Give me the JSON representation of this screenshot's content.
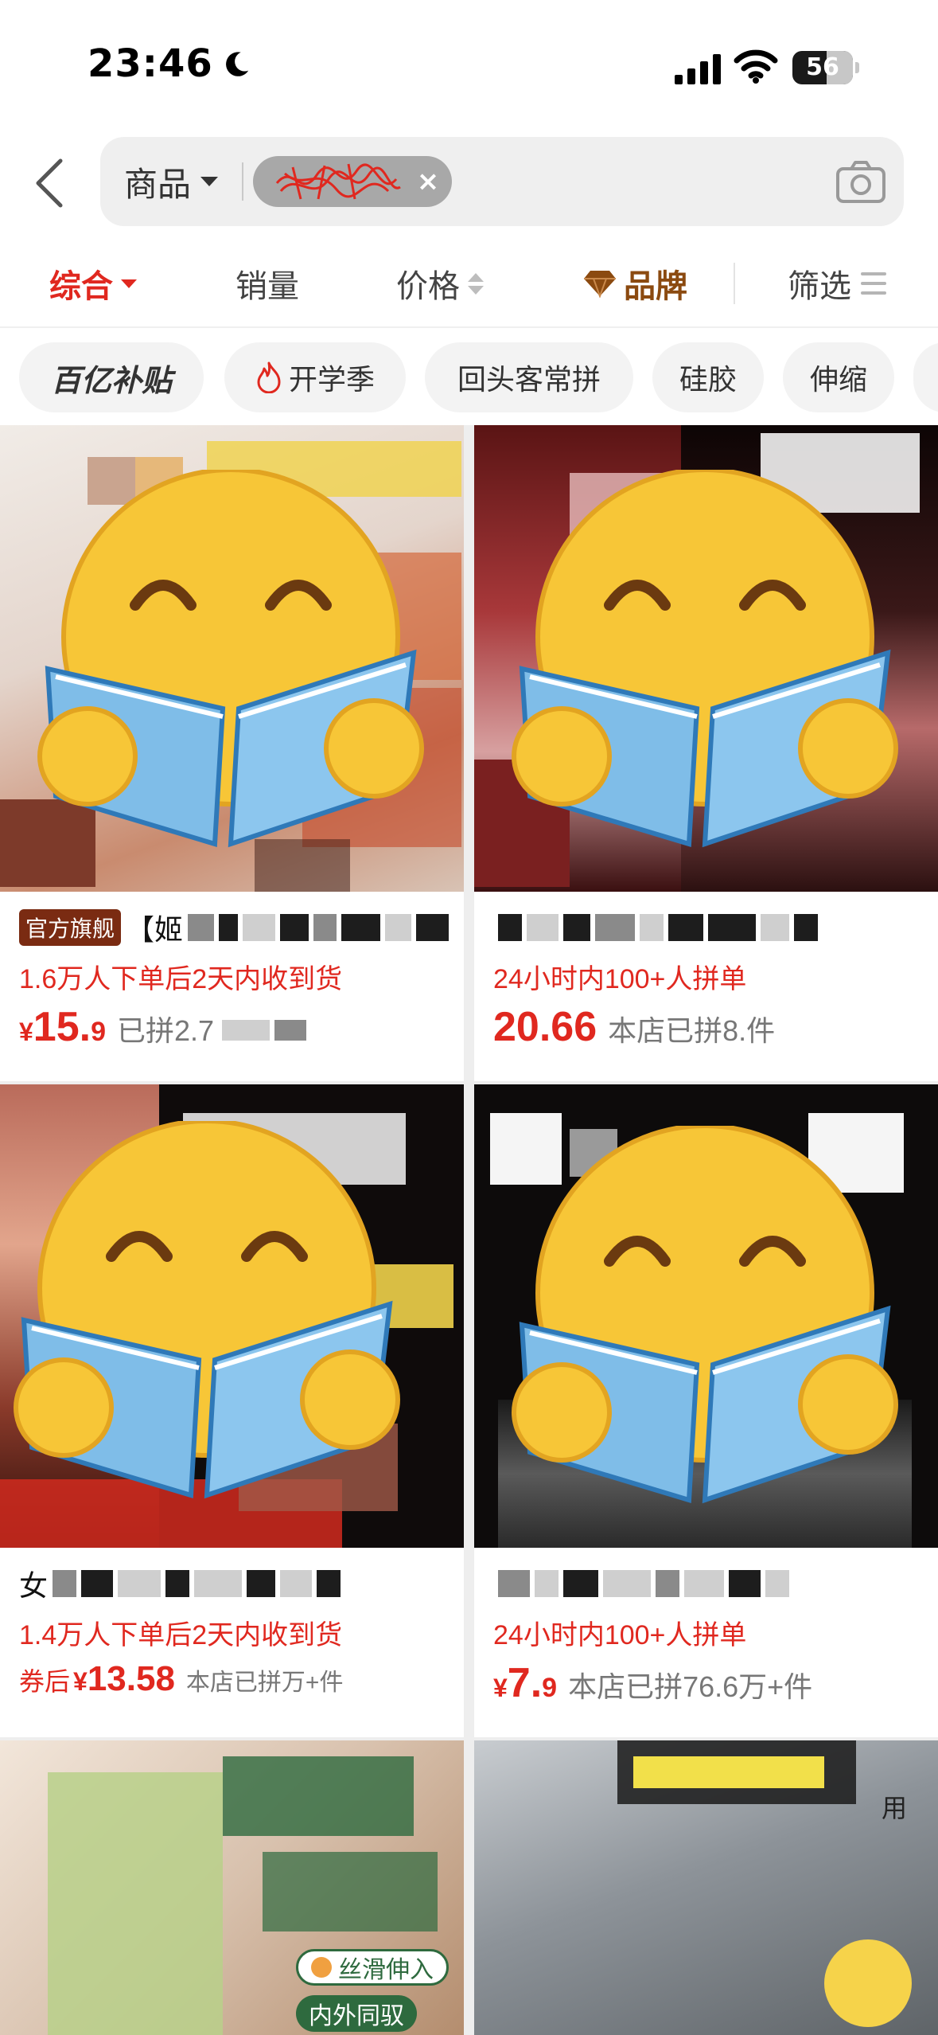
{
  "status_bar": {
    "time": "23:46",
    "battery": "56",
    "battery_level": 0.56
  },
  "search": {
    "scope_label": "商品",
    "chip_close": "×"
  },
  "sort_bar": {
    "items": [
      {
        "label": "综合",
        "active": true
      },
      {
        "label": "销量",
        "active": false
      },
      {
        "label": "价格",
        "active": false
      },
      {
        "label": "品牌",
        "active": false
      },
      {
        "label": "筛选",
        "active": false
      }
    ]
  },
  "tags": [
    {
      "label": "百亿补贴"
    },
    {
      "label": "开学季"
    },
    {
      "label": "回头客常拼"
    },
    {
      "label": "硅胶"
    },
    {
      "label": "伸缩"
    }
  ],
  "products": [
    {
      "badge": "官方旗舰",
      "title_visible": "【姬",
      "promo": "1.6万人下单后2天内收到货",
      "price_prefix": "",
      "price_yen": "¥",
      "price_int": "15.",
      "price_dec": "9",
      "sales": "已拼2.7"
    },
    {
      "title_visible": "",
      "promo": "24小时内100+人拼单",
      "price_prefix": "",
      "price_yen": "",
      "price_int": "20.66",
      "price_dec": "",
      "sales": "本店已拼8.件"
    },
    {
      "title_visible": "女",
      "promo": "1.4万人下单后2天内收到货",
      "price_prefix": "券后",
      "price_yen": "¥",
      "price_int": "13.58",
      "price_dec": "",
      "sales": "本店已拼万+件"
    },
    {
      "title_visible": "",
      "promo": "24小时内100+人拼单",
      "price_prefix": "",
      "price_yen": "¥",
      "price_int": "7.",
      "price_dec": "9",
      "sales": "本店已拼76.6万+件"
    }
  ],
  "bottom_image_texts": {
    "left_feature_1": "丝滑伸入",
    "left_feature_2": "内外同驭",
    "right_corner": "用"
  },
  "colors": {
    "accent": "#e0281f",
    "brand": "#8b4a10",
    "badge": "#7a2b12"
  }
}
